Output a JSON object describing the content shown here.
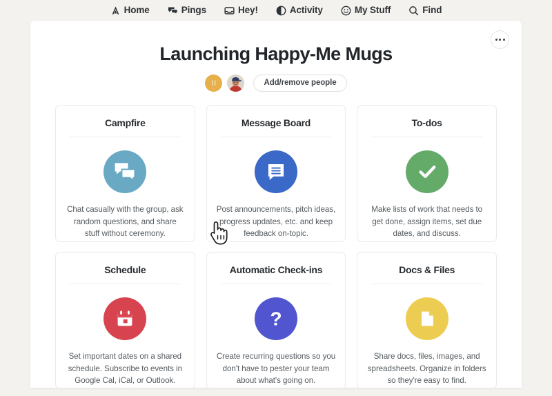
{
  "topnav": {
    "items": [
      {
        "label": "Home",
        "icon": "campfire-icon"
      },
      {
        "label": "Pings",
        "icon": "chat-bubbles-icon"
      },
      {
        "label": "Hey!",
        "icon": "inbox-tray-icon"
      },
      {
        "label": "Activity",
        "icon": "half-circle-icon"
      },
      {
        "label": "My Stuff",
        "icon": "smiley-face-icon"
      },
      {
        "label": "Find",
        "icon": "magnifier-icon"
      }
    ]
  },
  "header": {
    "title": "Launching Happy-Me Mugs",
    "menu_button": "...",
    "add_people_label": "Add/remove people",
    "avatars": [
      {
        "type": "initials",
        "initials": "II",
        "color": "#e8b04b"
      },
      {
        "type": "photo",
        "description": "person in red shirt and blue cap"
      }
    ]
  },
  "cards": [
    {
      "title": "Campfire",
      "text": "Chat casually with the group, ask random questions, and share stuff without ceremony.",
      "icon": "chat-bubbles-icon",
      "color": "#6aa9c4"
    },
    {
      "title": "Message Board",
      "text": "Post announcements, pitch ideas, progress updates, etc. and keep feedback on-topic.",
      "icon": "message-lines-icon",
      "color": "#3a69c7"
    },
    {
      "title": "To-dos",
      "text": "Make lists of work that needs to get done, assign items, set due dates, and discuss.",
      "icon": "checkmark-icon",
      "color": "#64ab6a"
    },
    {
      "title": "Schedule",
      "text": "Set important dates on a shared schedule. Subscribe to events in Google Cal, iCal, or Outlook.",
      "icon": "calendar-icon",
      "color": "#d7444f"
    },
    {
      "title": "Automatic Check-ins",
      "text": "Create recurring questions so you don't have to pester your team about what's going on.",
      "icon": "question-mark-icon",
      "color": "#5155cf"
    },
    {
      "title": "Docs & Files",
      "text": "Share docs, files, images, and spreadsheets. Organize in folders so they're easy to find.",
      "icon": "document-page-icon",
      "color": "#edcd51"
    }
  ]
}
